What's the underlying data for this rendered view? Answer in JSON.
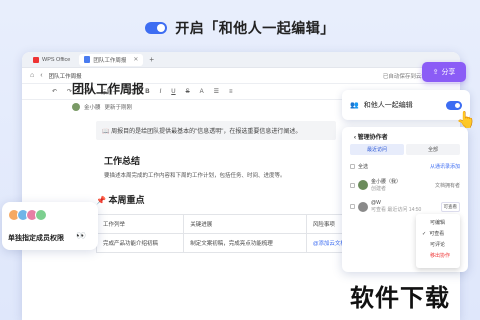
{
  "banner": {
    "text": "开启「和他人一起编辑」"
  },
  "tabs": [
    {
      "label": "WPS Office"
    },
    {
      "label": "团队工作周报"
    }
  ],
  "address": {
    "title": "团队工作周报",
    "status": "已自动保存到云端"
  },
  "share": {
    "label": "分享"
  },
  "toolbar": {
    "style": "标题一",
    "size": "22",
    "bold": "B"
  },
  "doc": {
    "title": "团队工作周报",
    "author": "金小腰",
    "update_link": "更新于刚刚",
    "quote": "周报目的是给团队提供最基本的\"信息透明\"，在报选重要信息进行阐述。",
    "section1": "工作总结",
    "section1_para": "要描述本周完成的工作内容和下周的工作计划，包括任务、时间、进度等。",
    "section2": "本周重点",
    "table": {
      "headers": [
        "工作列举",
        "关键进展",
        "风险事项"
      ],
      "row1": [
        "完成产品功能介绍初稿",
        "制定文案初稿，完成亮点功能梳理",
        "@添加云文档"
      ]
    }
  },
  "member_badge": {
    "label": "单独指定成员权限"
  },
  "collab_card": {
    "label": "和他人一起编辑"
  },
  "panel": {
    "title": "管理协作者",
    "tabs": [
      "最近访问",
      "全部"
    ],
    "select_all": "全选",
    "from_contacts": "从通讯录添加",
    "member1_name": "金小腰（我）",
    "member1_role": "创建者",
    "member1_perm": "文档拥有者",
    "member2_name": "@W",
    "member2_role": "可查看",
    "member2_time": "最近访问 14:50",
    "member2_perm": "可查看"
  },
  "dropdown": {
    "items": [
      "可编辑",
      "可查看",
      "可评论",
      "移出协作"
    ]
  },
  "watermark": {
    "text": "软件下载"
  }
}
